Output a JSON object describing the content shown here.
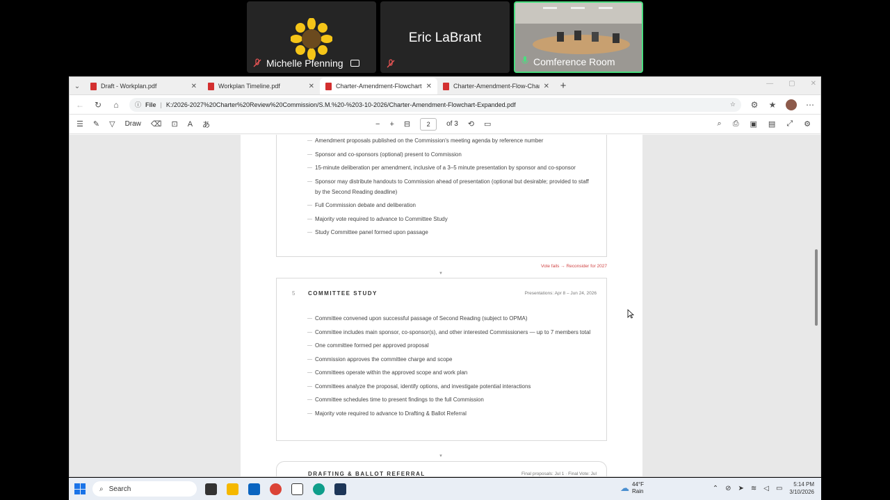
{
  "participants": [
    {
      "name": "Michelle Pfenning"
    },
    {
      "name": "Eric LaBrant"
    },
    {
      "name": "Comference Room"
    }
  ],
  "tabs": [
    {
      "label": "Draft - Workplan.pdf"
    },
    {
      "label": "Workplan Timeline.pdf"
    },
    {
      "label": "Charter-Amendment-Flowchart-E"
    },
    {
      "label": "Charter-Amendment-Flow-Chart.p"
    }
  ],
  "address": {
    "scheme": "File",
    "url": "K:/2026-2027%20Charter%20Review%20Commission/S.M.%20-%203-10-2026/Charter-Amendment-Flowchart-Expanded.pdf"
  },
  "pdf_toolbar": {
    "draw_label": "Draw",
    "page": "2",
    "of_pages": "of 3"
  },
  "doc": {
    "second_reading_items": [
      "Amendment proposals published on the Commission's meeting agenda by reference number",
      "Sponsor and co-sponsors (optional) present to Commission",
      "15-minute deliberation per amendment, inclusive of a 3–5 minute presentation by sponsor and co-sponsor",
      "Sponsor may distribute handouts to Commission ahead of presentation (optional but desirable; provided to staff by the Second Reading deadline)",
      "Full Commission debate and deliberation",
      "Majority vote required to advance to Committee Study",
      "Study Committee panel formed upon passage"
    ],
    "vote_fails": "Vote fails → Reconsider for 2027",
    "committee_study": {
      "number": "5",
      "title": "COMMITTEE STUDY",
      "meta": "Presentations: Apr 8 – Jun 24, 2026",
      "items": [
        "Committee convened upon successful passage of Second Reading (subject to OPMA)",
        "Committee includes main sponsor, co-sponsor(s), and other interested Commissioners — up to 7 members total",
        "One committee formed per approved proposal",
        "Commission approves the committee charge and scope",
        "Committees operate within the approved scope and work plan",
        "Committees analyze the proposal, identify options, and investigate potential interactions",
        "Committee schedules time to present findings to the full Commission",
        "Majority vote required to advance to Drafting & Ballot Referral"
      ]
    },
    "drafting": {
      "title": "DRAFTING & BALLOT REFERRAL",
      "meta": "Final proposals: Jul 1 · Final Vote: Jul"
    }
  },
  "taskbar": {
    "search_label": "Search",
    "weather_temp": "44°F",
    "weather_cond": "Rain",
    "time": "5:14 PM",
    "date": "3/10/2026"
  },
  "colors": {
    "active_speaker": "#4ade80",
    "pdf_tab": "#d32f2f",
    "vote_fails": "#d04545"
  }
}
